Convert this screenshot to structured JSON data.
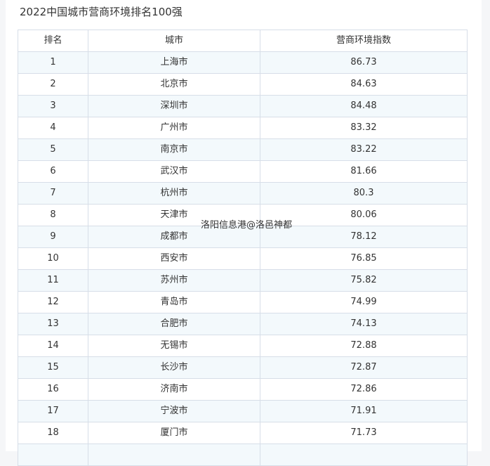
{
  "title": "2022中国城市营商环境排名100强",
  "watermark": "洛阳信息港@洛邑神都",
  "table": {
    "headers": [
      "排名",
      "城市",
      "营商环境指数"
    ],
    "rows": [
      [
        "1",
        "上海市",
        "86.73"
      ],
      [
        "2",
        "北京市",
        "84.63"
      ],
      [
        "3",
        "深圳市",
        "84.48"
      ],
      [
        "4",
        "广州市",
        "83.32"
      ],
      [
        "5",
        "南京市",
        "83.22"
      ],
      [
        "6",
        "武汉市",
        "81.66"
      ],
      [
        "7",
        "杭州市",
        "80.3"
      ],
      [
        "8",
        "天津市",
        "80.06"
      ],
      [
        "9",
        "成都市",
        "78.12"
      ],
      [
        "10",
        "西安市",
        "76.85"
      ],
      [
        "11",
        "苏州市",
        "75.82"
      ],
      [
        "12",
        "青岛市",
        "74.99"
      ],
      [
        "13",
        "合肥市",
        "74.13"
      ],
      [
        "14",
        "无锡市",
        "72.88"
      ],
      [
        "15",
        "长沙市",
        "72.87"
      ],
      [
        "16",
        "济南市",
        "72.86"
      ],
      [
        "17",
        "宁波市",
        "71.91"
      ],
      [
        "18",
        "厦门市",
        "71.73"
      ],
      [
        "",
        "",
        ""
      ]
    ]
  }
}
